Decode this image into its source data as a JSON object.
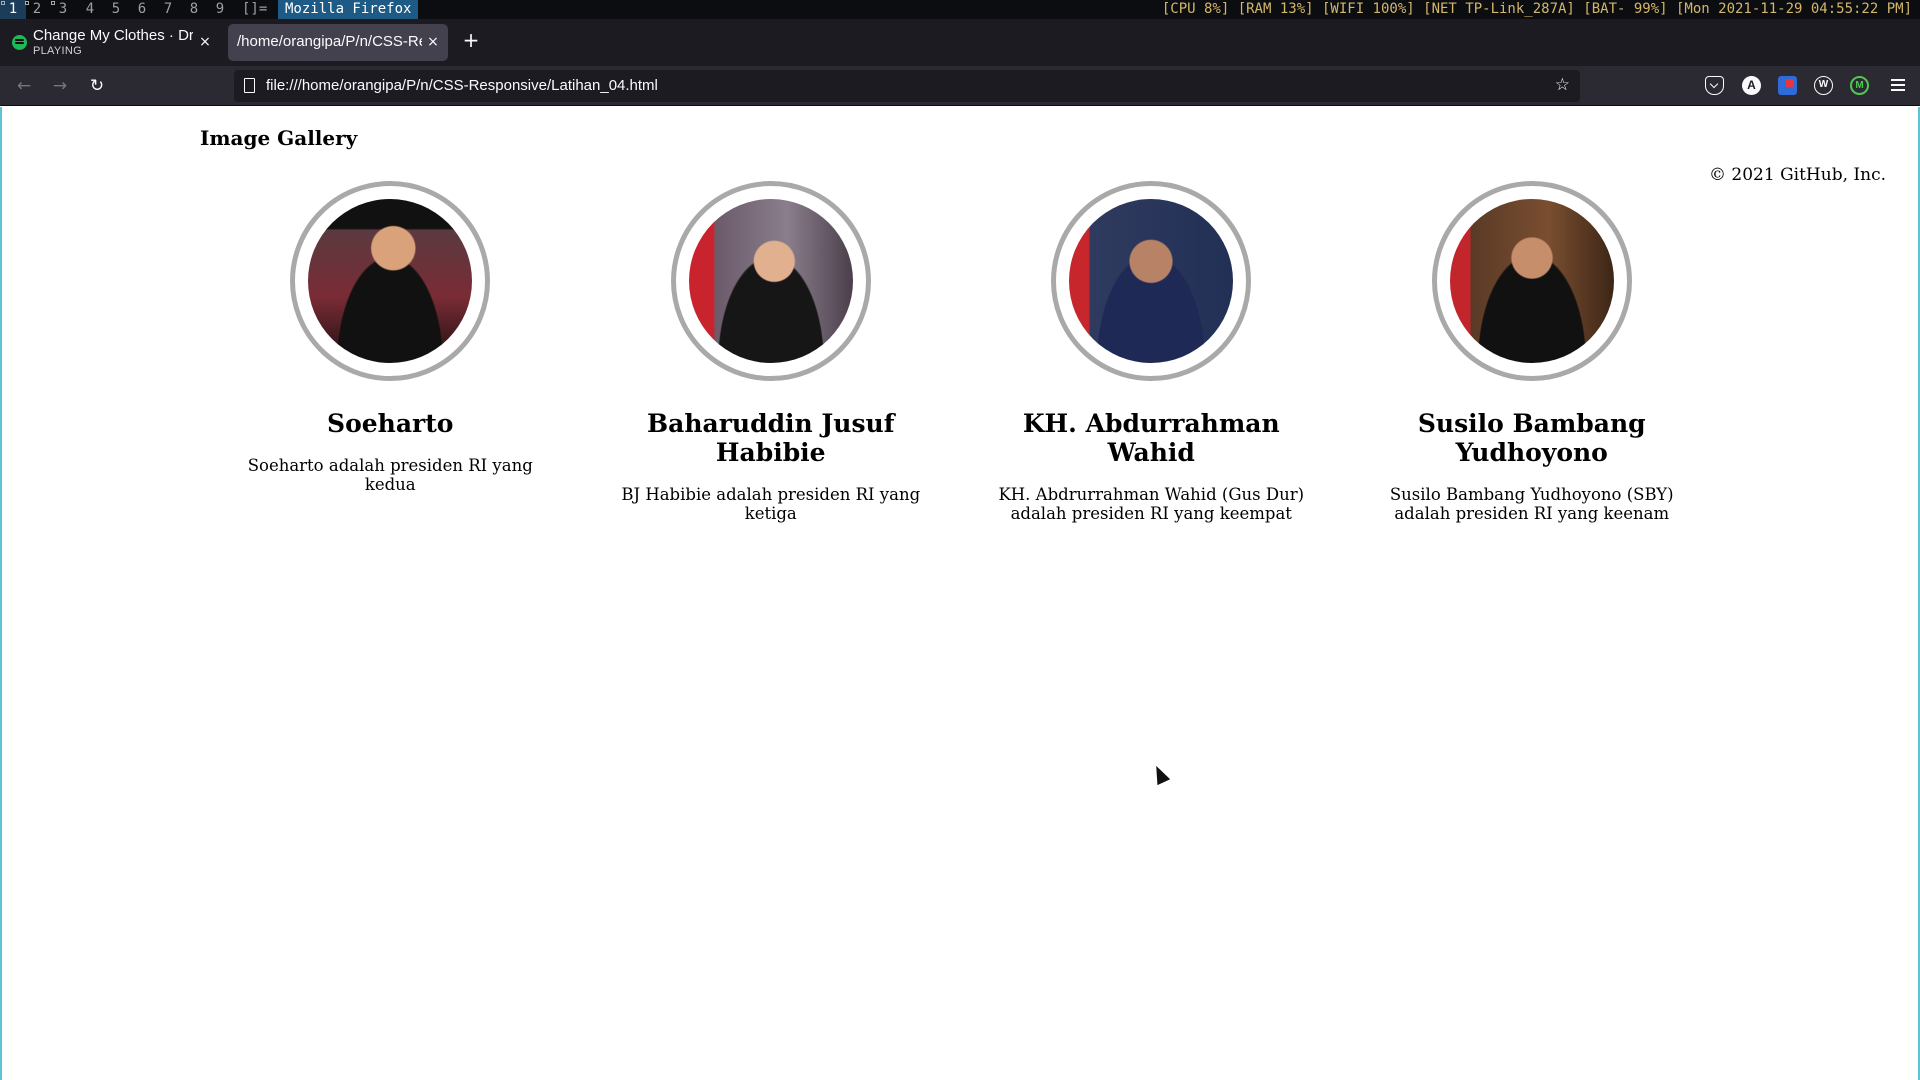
{
  "wm": {
    "workspaces": [
      "1",
      "2",
      "3",
      "4",
      "5",
      "6",
      "7",
      "8",
      "9"
    ],
    "layout_indicator": "[]=",
    "window_title": "Mozilla Firefox",
    "status": "[CPU 8%] [RAM 13%] [WIFI 100%] [NET TP-Link_287A] [BAT- 99%] [Mon 2021-11-29 04:55:22 PM]"
  },
  "browser": {
    "tabs": [
      {
        "title": "Change My Clothes · Drea",
        "subtitle": "PLAYING"
      },
      {
        "title": "/home/orangipa/P/n/CSS-Res"
      }
    ],
    "new_tab": "+",
    "close_glyph": "×",
    "url": "file:///home/orangipa/P/n/CSS-Responsive/Latihan_04.html",
    "addon_a_letter": "A",
    "addon_w_letter": "W",
    "addon_m_letter": "M"
  },
  "page": {
    "heading": "Image Gallery",
    "copyright": "© 2021 GitHub, Inc.",
    "cards": [
      {
        "name": "Soeharto",
        "desc": "Soeharto adalah presiden RI yang kedua"
      },
      {
        "name": "Baharuddin Jusuf Habibie",
        "desc": "BJ Habibie adalah presiden RI yang ketiga"
      },
      {
        "name": "KH. Abdurrahman Wahid",
        "desc": "KH. Abdrurrahman Wahid (Gus Dur) adalah presiden RI yang keempat"
      },
      {
        "name": "Susilo Bambang Yudhoyono",
        "desc": "Susilo Bambang Yudhoyono (SBY) adalah presiden RI yang keenam"
      }
    ]
  },
  "colors": {
    "accent_active_tab": "#42414d",
    "spotify_green": "#1db954",
    "avatar_border": "#a9a9a9"
  }
}
